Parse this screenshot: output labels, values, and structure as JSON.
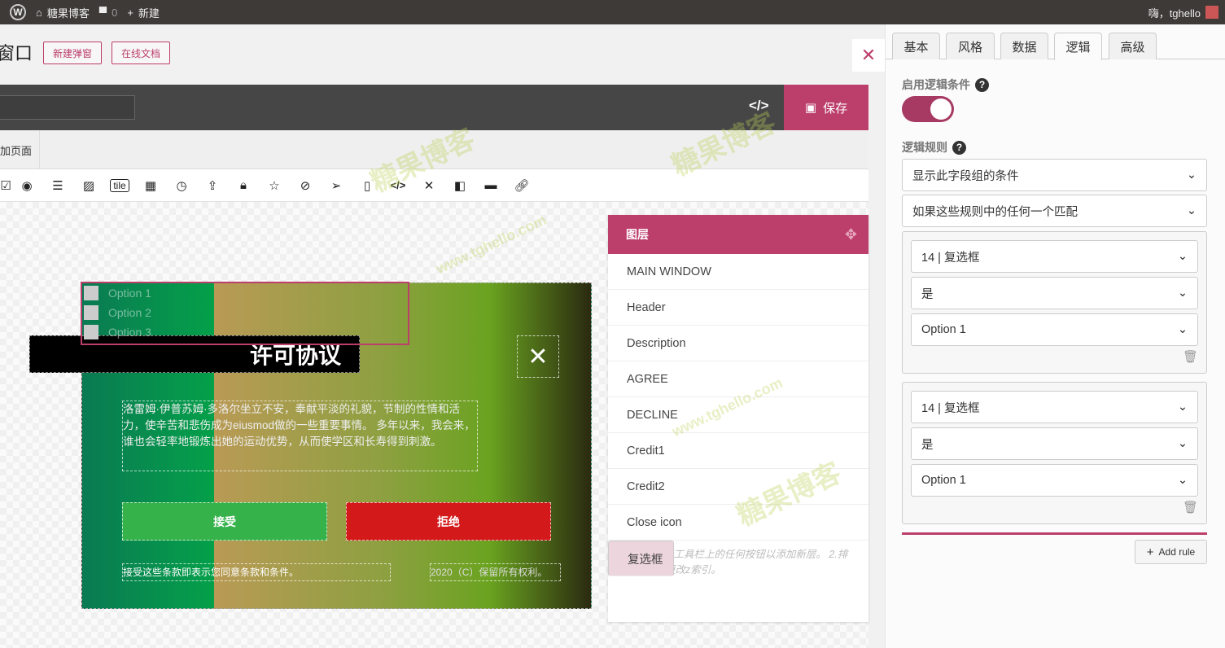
{
  "adminbar": {
    "site": "糖果博客",
    "comments": "0",
    "new": "新建",
    "greeting": "嗨，tghello"
  },
  "header": {
    "title": "窗口",
    "new_popup": "新建弹窗",
    "docs": "在线文档",
    "save": "保存",
    "tab_partial": "加页面"
  },
  "toolbar_icons": [
    "checkbox-icon",
    "radio-icon",
    "list-icon",
    "image-icon",
    "tile-icon",
    "calendar-icon",
    "clock-icon",
    "upload-icon",
    "lock-icon",
    "star-icon",
    "eye-slash-icon",
    "send-icon",
    "square-icon",
    "code-icon",
    "x-icon",
    "flag-icon",
    "ruler-icon",
    "link-icon"
  ],
  "toolbar_tile": "tile",
  "popup": {
    "options": [
      "Option 1",
      "Option 2",
      "Option 3"
    ],
    "title": "许可协议",
    "description": "洛雷姆·伊普苏姆·多洛尔坐立不安，奉献平淡的礼貌，节制的性情和活力，使辛苦和悲伤成为eiusmod做的一些重要事情。 多年以来，我会来，谁也会轻率地锻炼出她的运动优势，从而使学区和长寿得到刺激。",
    "accept": "接受",
    "decline": "拒绝",
    "terms": "接受这些条款即表示您同意条款和条件。",
    "copyright": "2020（C）保留所有权利。"
  },
  "layers": {
    "title": "图层",
    "items": [
      "MAIN WINDOW",
      "Header",
      "Description",
      "AGREE",
      "DECLINE",
      "Credit1",
      "Credit2",
      "Close icon",
      "复选框"
    ],
    "selected": "复选框",
    "hint": "1.单击元素工具栏上的任何按钮以添加新层。 2.排序图层以更改z索引。"
  },
  "right": {
    "tabs": [
      "基本",
      "风格",
      "数据",
      "逻辑",
      "高级"
    ],
    "active_tab": "逻辑",
    "enable_label": "启用逻辑条件",
    "enabled": true,
    "rules_label": "逻辑规则",
    "condition_select": "显示此字段组的条件",
    "match_select": "如果这些规则中的任何一个匹配",
    "rules": [
      {
        "field": "14 | 复选框",
        "operator": "是",
        "value": "Option 1"
      },
      {
        "field": "14 | 复选框",
        "operator": "是",
        "value": "Option 1"
      }
    ],
    "add_rule": "Add rule"
  },
  "watermarks": [
    "糖果博客",
    "www.tghello.com"
  ],
  "colors": {
    "accent": "#bc3e6b",
    "accept": "#35b24a",
    "decline": "#d4191b"
  }
}
